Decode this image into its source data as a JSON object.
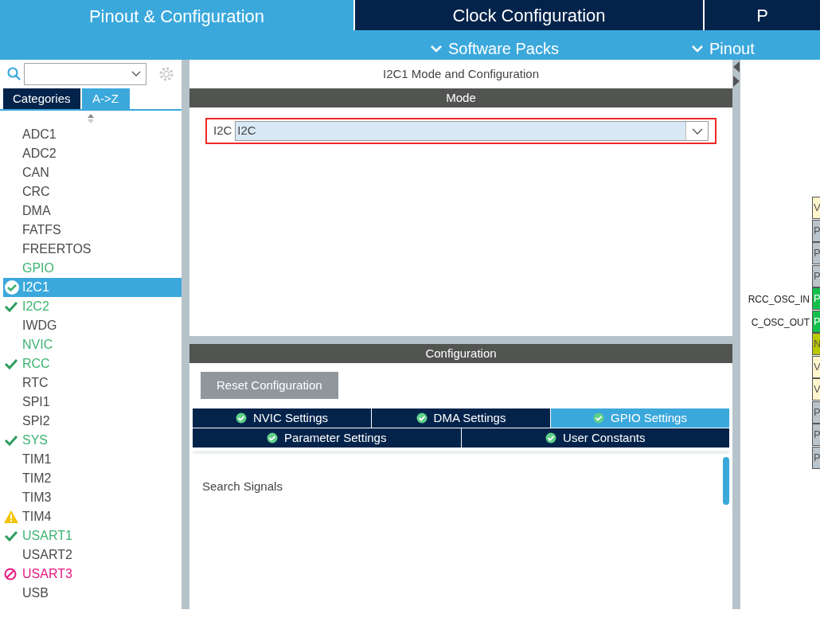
{
  "top_tabs": [
    {
      "label": "Pinout & Configuration",
      "selected": true
    },
    {
      "label": "Clock Configuration",
      "selected": false
    },
    {
      "label": "P",
      "selected": false
    }
  ],
  "sub_menu": [
    "Software Packs",
    "Pinout"
  ],
  "sidebar": {
    "view_tabs": [
      {
        "label": "Categories",
        "selected": false
      },
      {
        "label": "A->Z",
        "selected": true
      }
    ],
    "items": [
      {
        "label": "ADC1",
        "color": "#4a4a4a",
        "kind": "plain",
        "selected": false
      },
      {
        "label": "ADC2",
        "color": "#4a4a4a",
        "kind": "plain",
        "selected": false
      },
      {
        "label": "CAN",
        "color": "#4a4a4a",
        "kind": "plain",
        "selected": false
      },
      {
        "label": "CRC",
        "color": "#4a4a4a",
        "kind": "plain",
        "selected": false
      },
      {
        "label": "DMA",
        "color": "#4a4a4a",
        "kind": "plain",
        "selected": false
      },
      {
        "label": "FATFS",
        "color": "#4a4a4a",
        "kind": "plain",
        "selected": false
      },
      {
        "label": "FREERTOS",
        "color": "#4a4a4a",
        "kind": "plain",
        "selected": false
      },
      {
        "label": "GPIO",
        "color": "#3cb371",
        "kind": "plain",
        "selected": false
      },
      {
        "label": "I2C1",
        "kind": "ok",
        "selected": true
      },
      {
        "label": "I2C2",
        "color": "#3cb371",
        "kind": "ok",
        "selected": false
      },
      {
        "label": "IWDG",
        "color": "#4a4a4a",
        "kind": "plain",
        "selected": false
      },
      {
        "label": "NVIC",
        "color": "#3cb371",
        "kind": "plain",
        "selected": false
      },
      {
        "label": "RCC",
        "color": "#3cb371",
        "kind": "ok",
        "selected": false
      },
      {
        "label": "RTC",
        "color": "#4a4a4a",
        "kind": "plain",
        "selected": false
      },
      {
        "label": "SPI1",
        "color": "#4a4a4a",
        "kind": "plain",
        "selected": false
      },
      {
        "label": "SPI2",
        "color": "#4a4a4a",
        "kind": "plain",
        "selected": false
      },
      {
        "label": "SYS",
        "color": "#3cb371",
        "kind": "ok",
        "selected": false
      },
      {
        "label": "TIM1",
        "color": "#4a4a4a",
        "kind": "plain",
        "selected": false
      },
      {
        "label": "TIM2",
        "color": "#4a4a4a",
        "kind": "plain",
        "selected": false
      },
      {
        "label": "TIM3",
        "color": "#4a4a4a",
        "kind": "plain",
        "selected": false
      },
      {
        "label": "TIM4",
        "color": "#4a4a4a",
        "kind": "warning",
        "selected": false
      },
      {
        "label": "USART1",
        "color": "#3cb371",
        "kind": "ok",
        "selected": false
      },
      {
        "label": "USART2",
        "color": "#4a4a4a",
        "kind": "plain",
        "selected": false
      },
      {
        "label": "USART3",
        "color": "#e6177e",
        "kind": "error",
        "selected": false
      },
      {
        "label": "USB",
        "color": "#4a4a4a",
        "kind": "plain",
        "selected": false
      }
    ]
  },
  "panel_title": "I2C1 Mode and Configuration",
  "mode": {
    "header": "Mode",
    "label": "I2C",
    "value": "I2C"
  },
  "configuration": {
    "header": "Configuration",
    "reset_button": "Reset Configuration",
    "tab_rows": [
      [
        {
          "label": "NVIC Settings",
          "selected": false
        },
        {
          "label": "DMA Settings",
          "selected": false
        },
        {
          "label": "GPIO Settings",
          "selected": true
        }
      ],
      [
        {
          "label": "Parameter Settings",
          "selected": false
        },
        {
          "label": "User Constants",
          "selected": false
        }
      ]
    ],
    "search_label": "Search Signals"
  },
  "chip": {
    "pins": [
      {
        "label": "V",
        "color": "#fff5cc"
      },
      {
        "label": "P",
        "color": "#b9c4cc"
      },
      {
        "label": "P",
        "color": "#b9c4cc"
      },
      {
        "label": "P",
        "color": "#b9c4cc"
      },
      {
        "label": "P",
        "color": "#13c04a",
        "signal": "RCC_OSC_IN"
      },
      {
        "label": "P",
        "color": "#13c04a",
        "signal": "C_OSC_OUT"
      },
      {
        "label": "N",
        "color": "#bcc800"
      },
      {
        "label": "V",
        "color": "#fff5cc"
      },
      {
        "label": "V",
        "color": "#fff5cc"
      },
      {
        "label": "P",
        "color": "#b9c4cc"
      },
      {
        "label": "P",
        "color": "#b9c4cc"
      },
      {
        "label": "P",
        "color": "#b9c4cc"
      }
    ]
  }
}
